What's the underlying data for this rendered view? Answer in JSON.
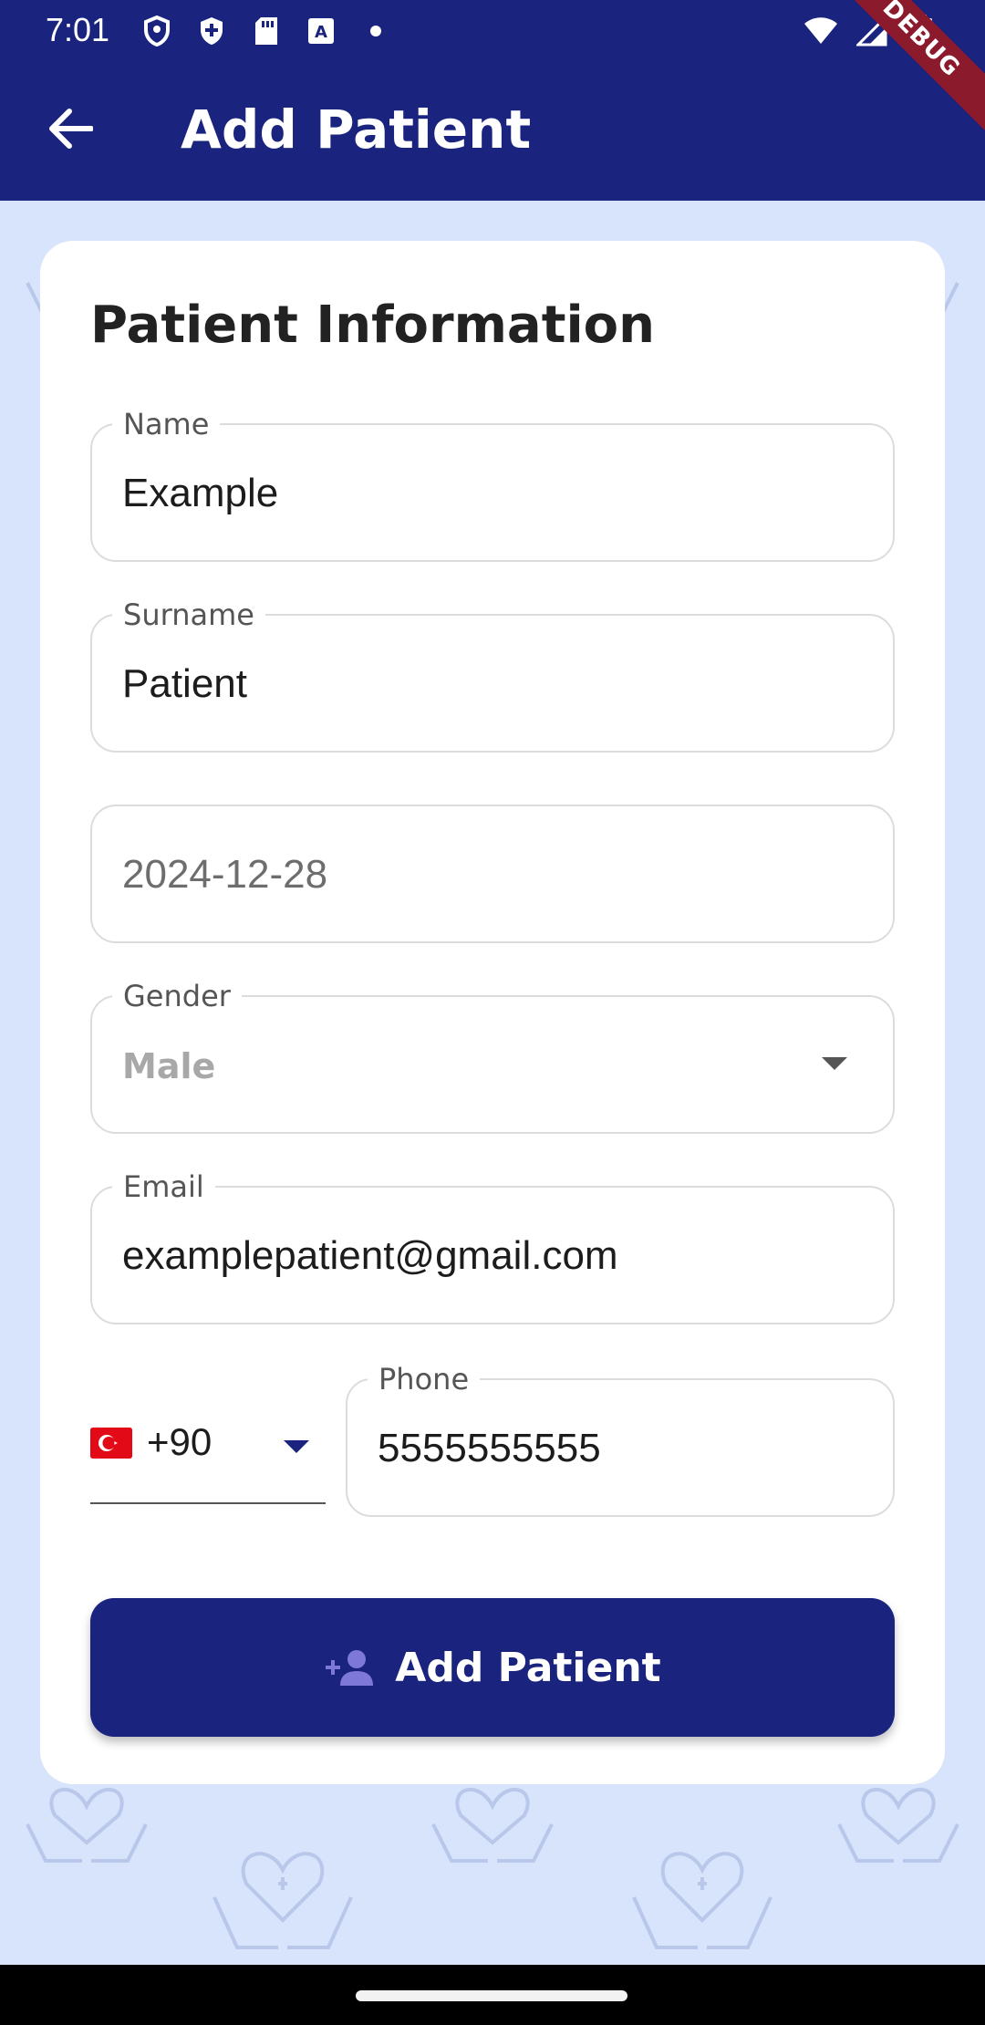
{
  "status_bar": {
    "time": "7:01",
    "icons_left": [
      "shield-icon",
      "shield-check-icon",
      "sd-card-icon",
      "text-a-icon",
      "dot-icon"
    ],
    "icons_right": [
      "wifi-icon",
      "signal-icon",
      "battery-icon"
    ]
  },
  "debug_banner": "DEBUG",
  "app_bar": {
    "title": "Add Patient",
    "back_icon": "arrow-back-icon"
  },
  "form": {
    "section_title": "Patient Information",
    "name": {
      "label": "Name",
      "value": "Example"
    },
    "surname": {
      "label": "Surname",
      "value": "Patient"
    },
    "birth_date": {
      "value": "2024-12-28"
    },
    "gender": {
      "label": "Gender",
      "value": "Male"
    },
    "email": {
      "label": "Email",
      "value": "examplepatient@gmail.com"
    },
    "phone": {
      "country_flag": "turkey-flag",
      "country_code": "+90",
      "label": "Phone",
      "value": "5555555555"
    },
    "submit_label": "Add Patient",
    "submit_icon": "person-add-icon"
  },
  "colors": {
    "primary": "#1a237e",
    "background": "#d8e4fb",
    "card": "#ffffff",
    "debug": "#8b1a2d"
  }
}
